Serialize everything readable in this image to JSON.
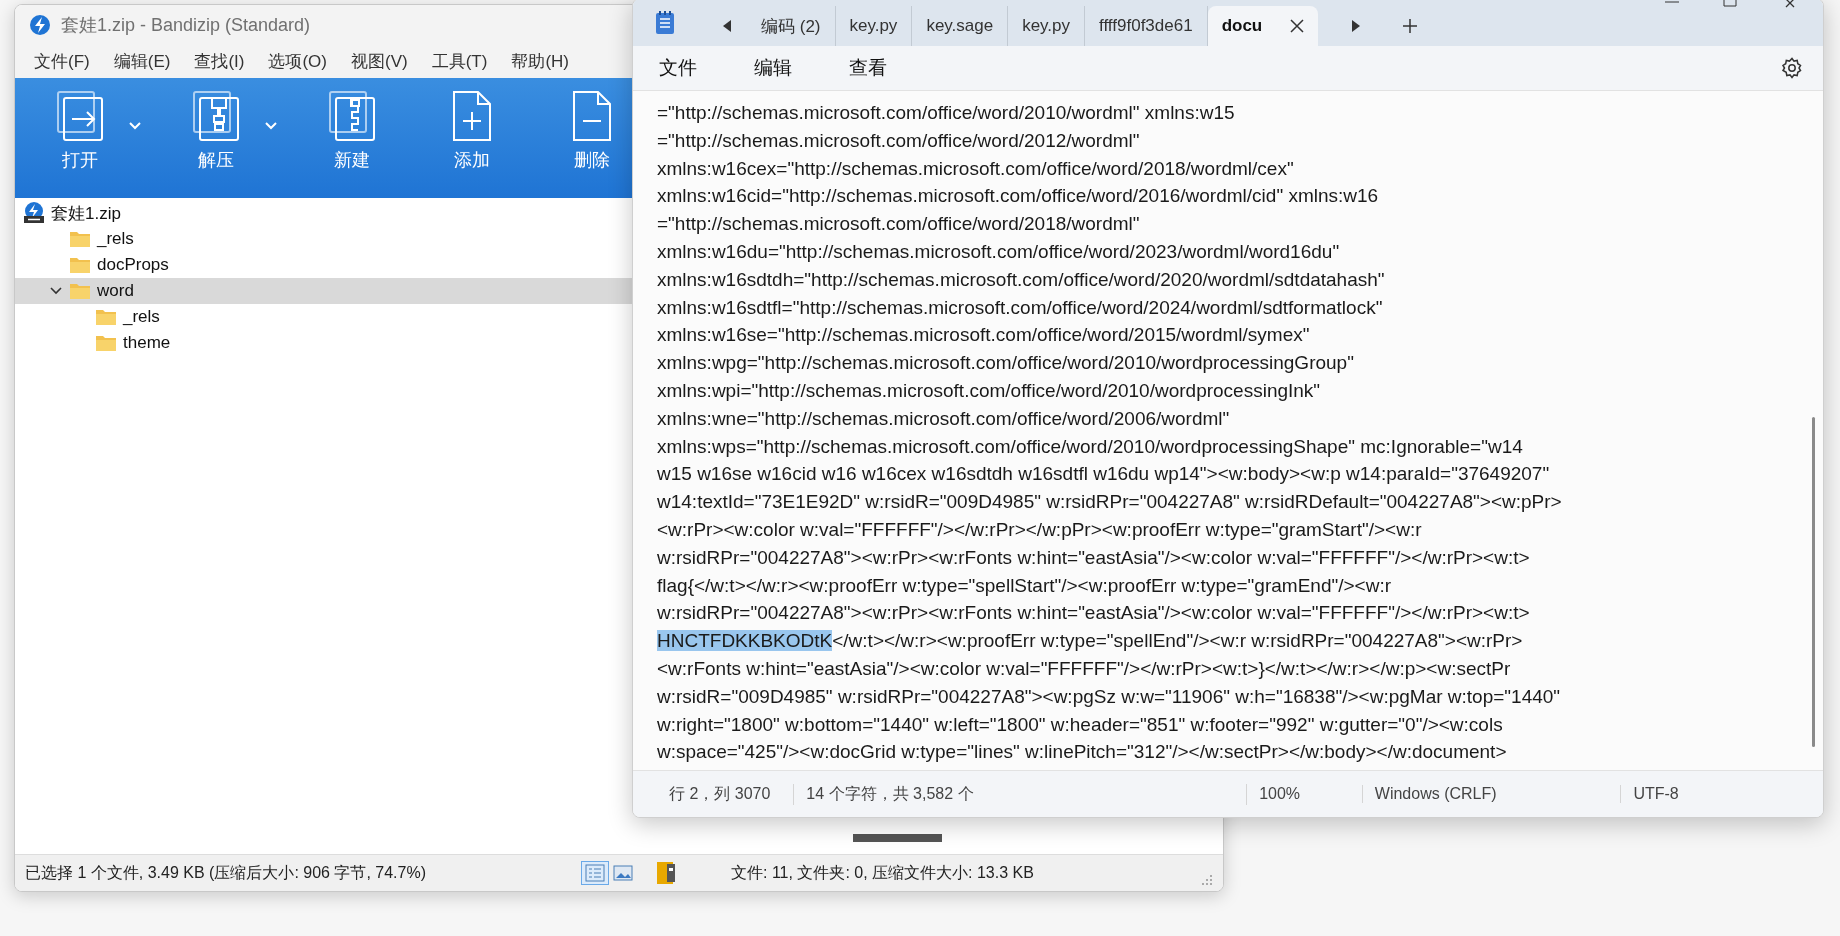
{
  "bandizip": {
    "window": {
      "title": "套娃1.zip - Bandizip (Standard)"
    },
    "menu": [
      "文件(F)",
      "编辑(E)",
      "查找(I)",
      "选项(O)",
      "视图(V)",
      "工具(T)",
      "帮助(H)"
    ],
    "toolbar": [
      {
        "label": "打开",
        "kind": "open",
        "dropdown": true
      },
      {
        "label": "解压",
        "kind": "extract",
        "dropdown": true
      },
      {
        "label": "新建",
        "kind": "new",
        "dropdown": false
      },
      {
        "label": "添加",
        "kind": "add",
        "dropdown": false
      },
      {
        "label": "删除",
        "kind": "delete",
        "dropdown": false
      }
    ],
    "tree": [
      {
        "label": "套娃1.zip",
        "kind": "archive",
        "selected": false,
        "children": [
          {
            "label": "_rels",
            "kind": "folder",
            "selected": false
          },
          {
            "label": "docProps",
            "kind": "folder",
            "selected": false
          },
          {
            "label": "word",
            "kind": "folder",
            "selected": true,
            "expanded": true,
            "children": [
              {
                "label": "_rels",
                "kind": "folder",
                "selected": false
              },
              {
                "label": "theme",
                "kind": "folder",
                "selected": false
              }
            ]
          }
        ]
      }
    ],
    "status_bar": {
      "selection": "已选择 1 个文件, 3.49 KB (压缩后大小: 906 字节, 74.7%)",
      "view_buttons": [
        {
          "kind": "details",
          "selected": true
        },
        {
          "kind": "thumbnails",
          "selected": false
        }
      ],
      "summary": "文件: 11, 文件夹: 0, 压缩文件大小: 13.3 KB"
    }
  },
  "notepad": {
    "tabs": [
      {
        "label": "编码 (2)",
        "selected": false
      },
      {
        "label": "key.py",
        "selected": false
      },
      {
        "label": "key.sage",
        "selected": false
      },
      {
        "label": "key.py",
        "selected": false
      },
      {
        "label": "ffff9f0f3de61",
        "selected": false
      },
      {
        "label": "docu",
        "selected": true
      }
    ],
    "menu": [
      "文件",
      "编辑",
      "查看"
    ],
    "lines": [
      [
        {
          "text": "=\"http://schemas.microsoft.com/office/word/2010/wordml\" xmlns:w15",
          "selected": false
        }
      ],
      [
        {
          "text": "=\"http://schemas.microsoft.com/office/word/2012/wordml\"",
          "selected": false
        }
      ],
      [
        {
          "text": "xmlns:w16cex=\"http://schemas.microsoft.com/office/word/2018/wordml/cex\"",
          "selected": false
        }
      ],
      [
        {
          "text": "xmlns:w16cid=\"http://schemas.microsoft.com/office/word/2016/wordml/cid\" xmlns:w16",
          "selected": false
        }
      ],
      [
        {
          "text": "=\"http://schemas.microsoft.com/office/word/2018/wordml\"",
          "selected": false
        }
      ],
      [
        {
          "text": "xmlns:w16du=\"http://schemas.microsoft.com/office/word/2023/wordml/word16du\"",
          "selected": false
        }
      ],
      [
        {
          "text": "xmlns:w16sdtdh=\"http://schemas.microsoft.com/office/word/2020/wordml/sdtdatahash\"",
          "selected": false
        }
      ],
      [
        {
          "text": "xmlns:w16sdtfl=\"http://schemas.microsoft.com/office/word/2024/wordml/sdtformatlock\"",
          "selected": false
        }
      ],
      [
        {
          "text": "xmlns:w16se=\"http://schemas.microsoft.com/office/word/2015/wordml/symex\"",
          "selected": false
        }
      ],
      [
        {
          "text": "xmlns:wpg=\"http://schemas.microsoft.com/office/word/2010/wordprocessingGroup\"",
          "selected": false
        }
      ],
      [
        {
          "text": "xmlns:wpi=\"http://schemas.microsoft.com/office/word/2010/wordprocessingInk\"",
          "selected": false
        }
      ],
      [
        {
          "text": "xmlns:wne=\"http://schemas.microsoft.com/office/word/2006/wordml\"",
          "selected": false
        }
      ],
      [
        {
          "text": "xmlns:wps=\"http://schemas.microsoft.com/office/word/2010/wordprocessingShape\" mc:Ignorable=\"w14",
          "selected": false
        }
      ],
      [
        {
          "text": "w15 w16se w16cid w16 w16cex w16sdtdh w16sdtfl w16du wp14\"><w:body><w:p w14:paraId=\"37649207\"",
          "selected": false
        }
      ],
      [
        {
          "text": "w14:textId=\"73E1E92D\" w:rsidR=\"009D4985\" w:rsidRPr=\"004227A8\" w:rsidRDefault=\"004227A8\"><w:pPr>",
          "selected": false
        }
      ],
      [
        {
          "text": "<w:rPr><w:color w:val=\"FFFFFF\"/></w:rPr></w:pPr><w:proofErr w:type=\"gramStart\"/><w:r",
          "selected": false
        }
      ],
      [
        {
          "text": "w:rsidRPr=\"004227A8\"><w:rPr><w:rFonts w:hint=\"eastAsia\"/><w:color w:val=\"FFFFFF\"/></w:rPr><w:t>",
          "selected": false
        }
      ],
      [
        {
          "text": "flag{</w:t></w:r><w:proofErr w:type=\"spellStart\"/><w:proofErr w:type=\"gramEnd\"/><w:r",
          "selected": false
        }
      ],
      [
        {
          "text": "w:rsidRPr=\"004227A8\"><w:rPr><w:rFonts w:hint=\"eastAsia\"/><w:color w:val=\"FFFFFF\"/></w:rPr><w:t>",
          "selected": false
        }
      ],
      [
        {
          "text": "HNCTFDKKBKODtK",
          "selected": true
        },
        {
          "text": "</w:t></w:r><w:proofErr w:type=\"spellEnd\"/><w:r w:rsidRPr=\"004227A8\"><w:rPr>",
          "selected": false
        }
      ],
      [
        {
          "text": "<w:rFonts w:hint=\"eastAsia\"/><w:color w:val=\"FFFFFF\"/></w:rPr><w:t>}</w:t></w:r></w:p><w:sectPr",
          "selected": false
        }
      ],
      [
        {
          "text": "w:rsidR=\"009D4985\" w:rsidRPr=\"004227A8\"><w:pgSz w:w=\"11906\" w:h=\"16838\"/><w:pgMar w:top=\"1440\"",
          "selected": false
        }
      ],
      [
        {
          "text": "w:right=\"1800\" w:bottom=\"1440\" w:left=\"1800\" w:header=\"851\" w:footer=\"992\" w:gutter=\"0\"/><w:cols",
          "selected": false
        }
      ],
      [
        {
          "text": "w:space=\"425\"/><w:docGrid w:type=\"lines\" w:linePitch=\"312\"/></w:sectPr></w:body></w:document>",
          "selected": false
        }
      ]
    ],
    "status_bar": [
      "行 2，列 3070",
      "14 个字符，共 3,582 个",
      "100%",
      "Windows (CRLF)",
      "UTF-8"
    ]
  }
}
